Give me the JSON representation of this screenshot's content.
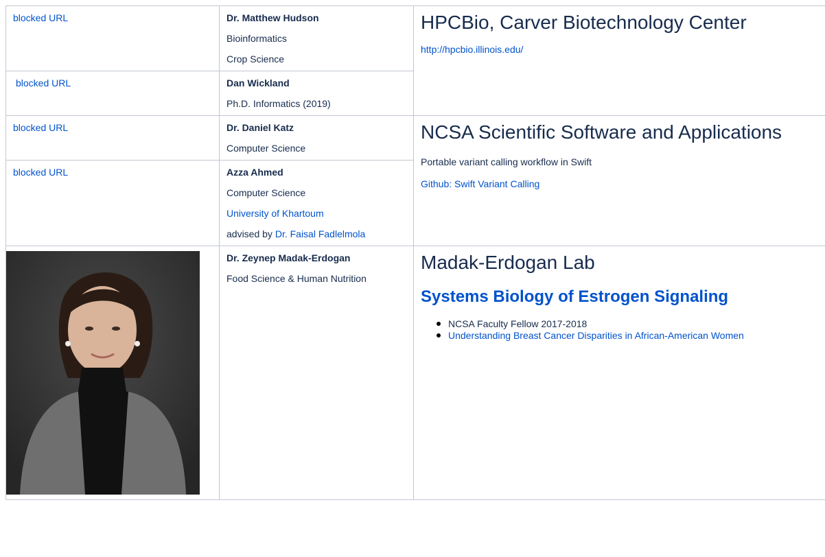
{
  "rows": {
    "hudson": {
      "link": "blocked URL",
      "name": "Dr. Matthew Hudson",
      "dept1": "Bioinformatics",
      "dept2": "Crop Science"
    },
    "wickland": {
      "link": "blocked URL",
      "name": "Dan Wickland",
      "dept1": "Ph.D. Informatics (2019)"
    },
    "hpcbio": {
      "title": "HPCBio, Carver Biotechnology Center",
      "url": "http://hpcbio.illinois.edu/"
    },
    "katz": {
      "link": "blocked URL",
      "name": "Dr. Daniel Katz",
      "dept1": "Computer Science"
    },
    "ahmed": {
      "link": "blocked URL",
      "name": "Azza Ahmed",
      "dept1": "Computer Science",
      "university": "University of Khartoum",
      "advised_prefix": "advised by ",
      "advisor": "Dr. Faisal Fadlelmola"
    },
    "ncsa": {
      "title": "NCSA Scientific Software and Applications",
      "desc": "Portable variant calling workflow in Swift",
      "github": "Github: Swift Variant Calling"
    },
    "erdogan": {
      "name": "Dr. Zeynep Madak-Erdogan",
      "dept1": "Food Science & Human Nutrition"
    },
    "lab": {
      "title": "Madak-Erdogan Lab",
      "subtitle": "Systems Biology of Estrogen Signaling",
      "bullets": [
        "NCSA Faculty Fellow 2017-2018",
        "Understanding Breast Cancer Disparities in African-American Women"
      ]
    }
  },
  "colors": {
    "link": "#0052cc",
    "text": "#172b4d",
    "border": "#c1c7d0"
  }
}
